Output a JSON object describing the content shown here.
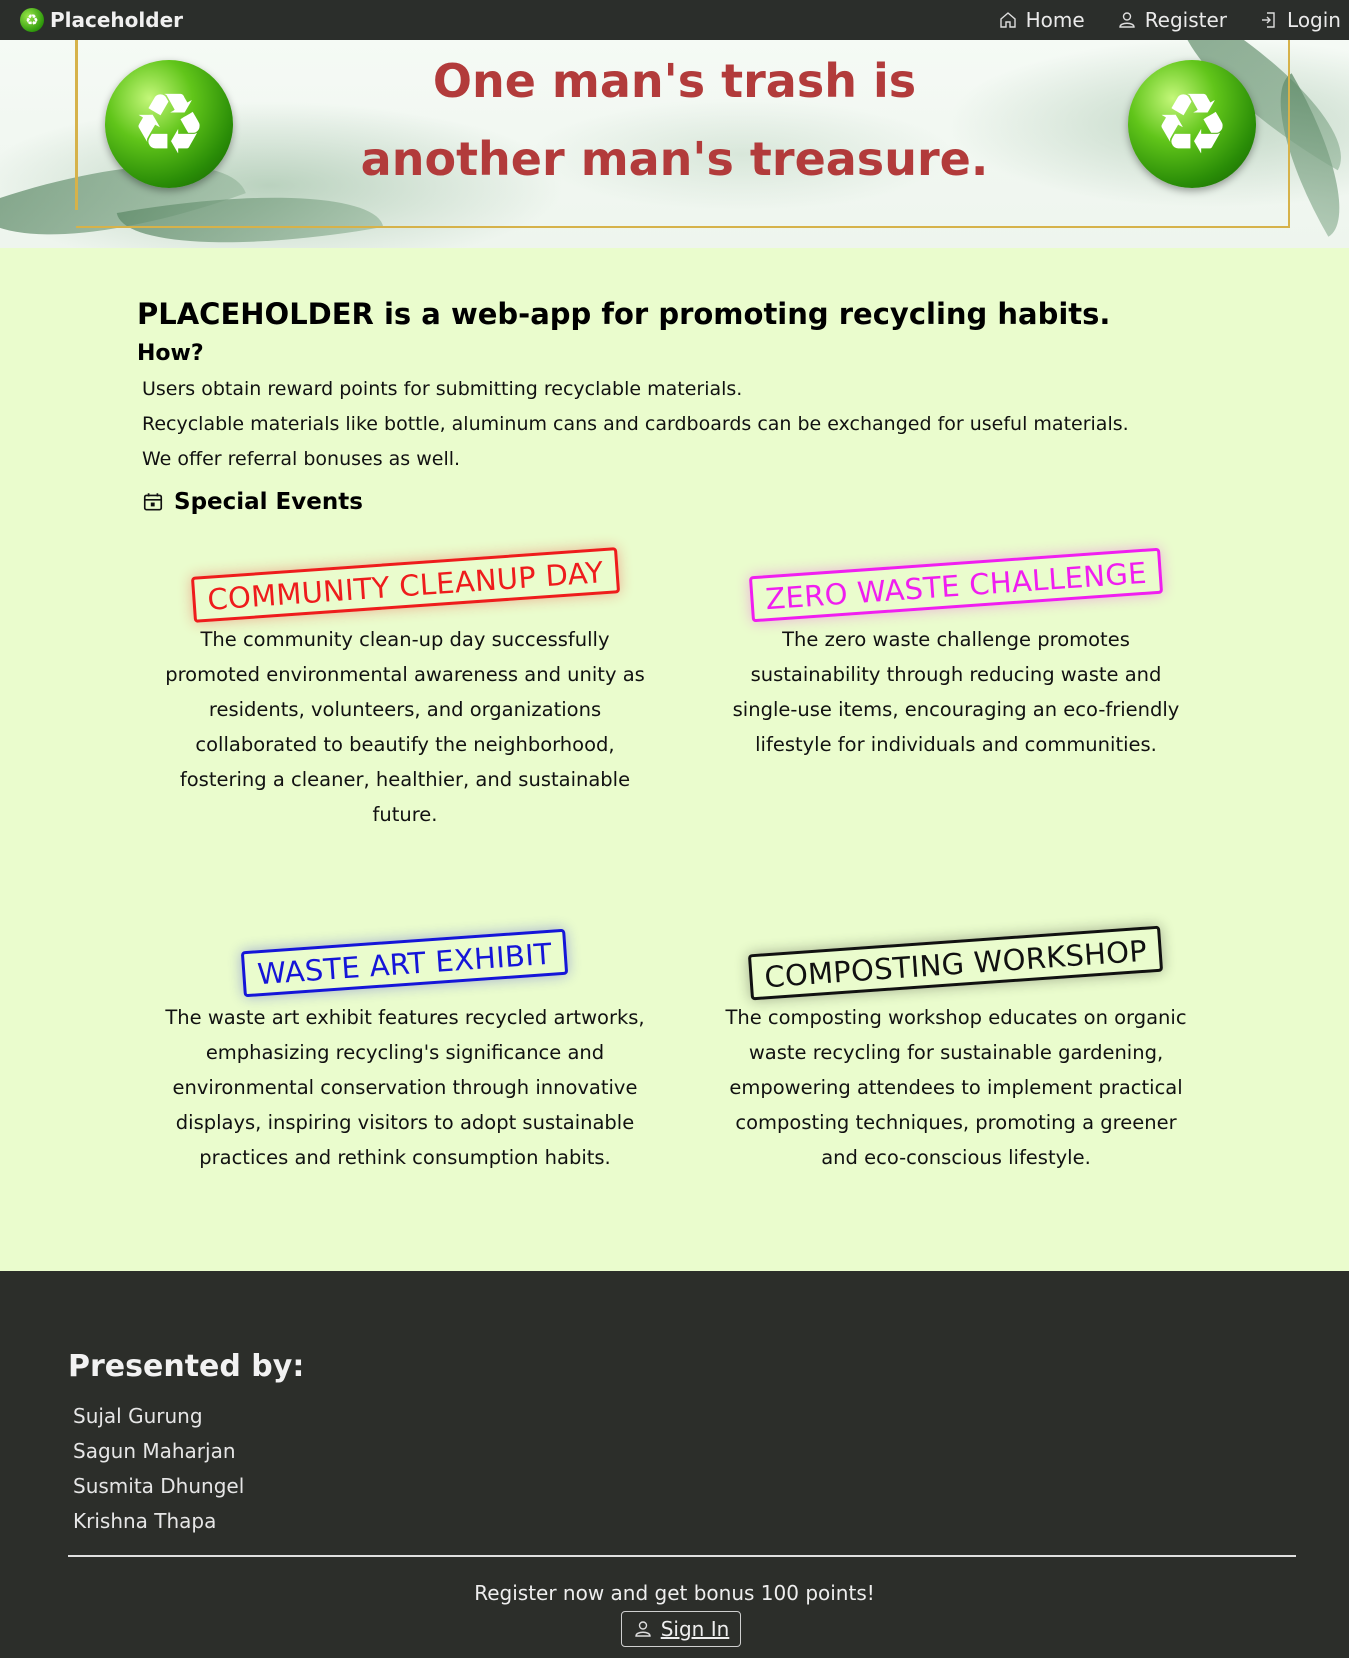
{
  "nav": {
    "brand": "Placeholder",
    "links": [
      {
        "label": "Home",
        "icon": "house-icon"
      },
      {
        "label": "Register",
        "icon": "person-icon"
      },
      {
        "label": "Login",
        "icon": "login-icon"
      }
    ]
  },
  "hero": {
    "line1": "One man's trash is",
    "line2": "another man's treasure.",
    "left_image": "recycle-ball-icon",
    "right_image": "recycle-ball-icon"
  },
  "intro": {
    "title": "PLACEHOLDER is a web-app for promoting recycling habits.",
    "how_heading": "How?",
    "points": [
      "Users obtain reward points for submitting recyclable materials.",
      "Recyclable materials like bottle, aluminum cans and cardboards can be exchanged for useful materials.",
      "We offer referral bonuses as well."
    ],
    "events_heading": "Special Events"
  },
  "events": [
    {
      "title": "COMMUNITY CLEANUP DAY",
      "color": "#ee1c1c",
      "description": "The community clean-up day successfully promoted environmental awareness and unity as residents, volunteers, and organizations collaborated to beautify the neighborhood, fostering a cleaner, healthier, and sustainable future."
    },
    {
      "title": "ZERO WASTE CHALLENGE",
      "color": "#f01ef0",
      "description": "The zero waste challenge promotes sustainability through reducing waste and single-use items, encouraging an eco-friendly lifestyle for individuals and communities."
    },
    {
      "title": "WASTE ART EXHIBIT",
      "color": "#1515d8",
      "description": "The waste art exhibit features recycled artworks, emphasizing recycling's significance and environmental conservation through innovative displays, inspiring visitors to adopt sustainable practices and rethink consumption habits."
    },
    {
      "title": "COMPOSTING WORKSHOP",
      "color": "#111111",
      "description": "The composting workshop educates on organic waste recycling for sustainable gardening, empowering attendees to implement practical composting techniques, promoting a greener and eco-conscious lifestyle."
    }
  ],
  "footer": {
    "presented_heading": "Presented by:",
    "members": [
      "Sujal Gurung",
      "Sagun Maharjan",
      "Susmita Dhungel",
      "Krishna Thapa"
    ],
    "cta": "Register now and get bonus 100 points!",
    "signin_label": "Sign In"
  },
  "colors": {
    "page_bg": "#eafccd",
    "nav_bg": "#2b2e2b",
    "hero_text": "#b23b3b",
    "footer_bg": "#2c2e2a"
  }
}
